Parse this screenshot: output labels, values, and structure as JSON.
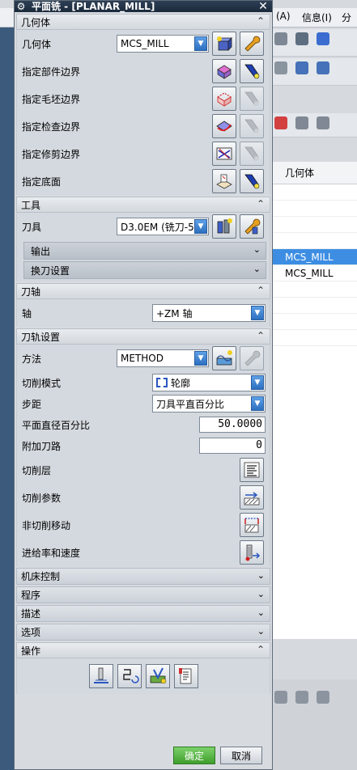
{
  "background": {
    "menus": [
      "(A)",
      "信息(I)",
      "分"
    ],
    "table": {
      "header": "几何体",
      "rows": [
        {
          "value": "MCS_MILL",
          "selected": true
        },
        {
          "value": "MCS_MILL",
          "selected": false
        }
      ]
    }
  },
  "dialog": {
    "title": "平面铣 - [PLANAR_MILL]",
    "close_symbol": "✕",
    "sections": {
      "geometry": {
        "header": "几何体",
        "geometry_label": "几何体",
        "geometry_value": "MCS_MILL",
        "rows": [
          "指定部件边界",
          "指定毛坯边界",
          "指定检查边界",
          "指定修剪边界",
          "指定底面"
        ]
      },
      "tool": {
        "header": "工具",
        "tool_label": "刀具",
        "tool_value": "D3.0EM (铣刀-5",
        "output_label": "输出",
        "tool_change_label": "换刀设置"
      },
      "tool_axis": {
        "header": "刀轴",
        "axis_label": "轴",
        "axis_value": "+ZM 轴"
      },
      "path_settings": {
        "header": "刀轨设置",
        "method_label": "方法",
        "method_value": "METHOD",
        "cut_pattern_label": "切削模式",
        "cut_pattern_value": "轮廓",
        "stepover_label": "步距",
        "stepover_value": "刀具平直百分比",
        "flat_diameter_label": "平面直径百分比",
        "flat_diameter_value": "50.0000",
        "additional_passes_label": "附加刀路",
        "additional_passes_value": "0",
        "cut_levels_label": "切削层",
        "cut_params_label": "切削参数",
        "noncut_moves_label": "非切削移动",
        "feeds_speeds_label": "进给率和速度"
      },
      "collapsed": [
        "机床控制",
        "程序",
        "描述",
        "选项"
      ],
      "actions": {
        "header": "操作"
      }
    },
    "buttons": {
      "ok": "确定",
      "cancel": "取消"
    }
  },
  "colors": {
    "title_bar": "#1f2f44",
    "selected_row": "#3d8ee3",
    "ok_button": "#3f9e2c"
  }
}
